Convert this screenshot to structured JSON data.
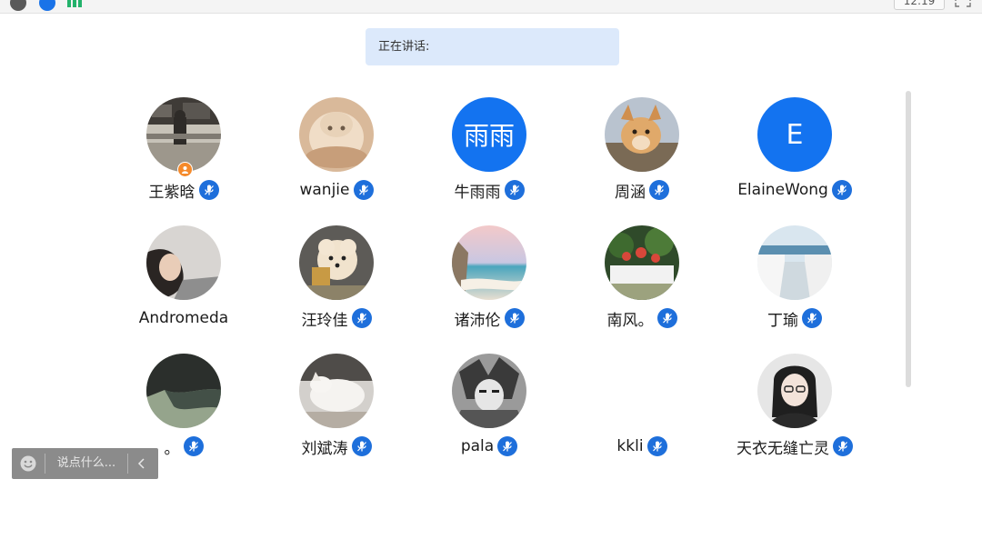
{
  "topbar": {
    "time": "12:19",
    "icons": [
      "info-icon",
      "shield-icon",
      "bar-grid-icon",
      "fullscreen-icon"
    ]
  },
  "speaking": {
    "label": "正在讲话:"
  },
  "participants": [
    {
      "name": "王紫晗",
      "avatar": "photo",
      "host": true
    },
    {
      "name": "wanjie",
      "avatar": "photo"
    },
    {
      "name": "牛雨雨",
      "avatar": "text",
      "avatar_text": "雨雨"
    },
    {
      "name": "周涵",
      "avatar": "photo"
    },
    {
      "name": "ElaineWong",
      "avatar": "text",
      "avatar_text": "E"
    },
    {
      "name": "Andromeda",
      "avatar": "photo",
      "mic": false
    },
    {
      "name": "汪玲佳",
      "avatar": "photo"
    },
    {
      "name": "诸沛伦",
      "avatar": "photo"
    },
    {
      "name": "南风。",
      "avatar": "photo"
    },
    {
      "name": "丁瑜",
      "avatar": "photo"
    },
    {
      "name": "。",
      "avatar": "photo"
    },
    {
      "name": "刘斌涛",
      "avatar": "photo"
    },
    {
      "name": "pala",
      "avatar": "photo"
    },
    {
      "name": "kkli",
      "avatar": "none"
    },
    {
      "name": "天衣无缝亡灵",
      "avatar": "photo"
    }
  ],
  "chat": {
    "placeholder": "说点什么..."
  },
  "colors": {
    "accent": "#1373f0",
    "mic": "#1e6fdb",
    "banner": "#dce9fb",
    "host_badge": "#f58a2b"
  }
}
